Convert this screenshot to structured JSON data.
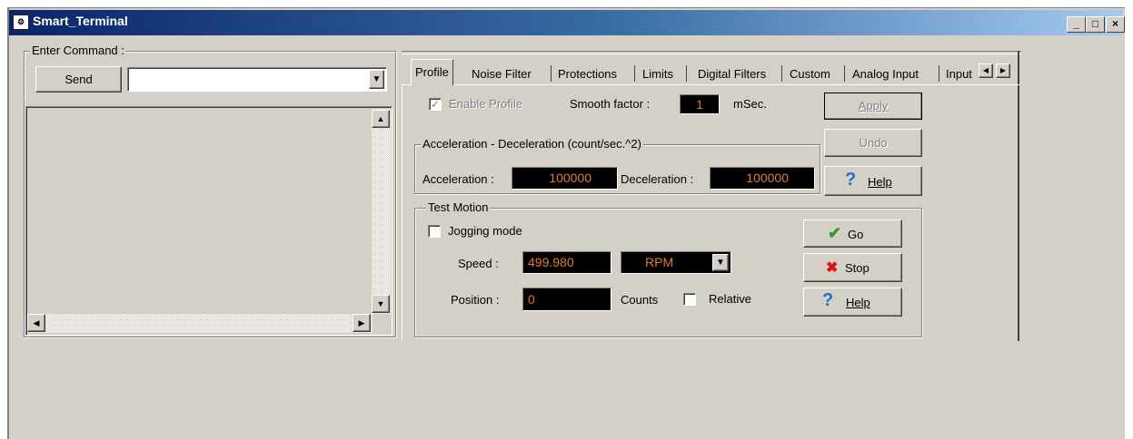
{
  "window": {
    "title": "Smart_Terminal",
    "controls": {
      "minimize": "_",
      "maximize": "□",
      "close": "×"
    },
    "app_icon": "terminal-app-icon"
  },
  "command_panel": {
    "group_label": "Enter Command :",
    "send_label": "Send",
    "command_value": ""
  },
  "tabs": {
    "items": [
      "Profile",
      "Noise Filter",
      "Protections",
      "Limits",
      "Digital Filters",
      "Custom",
      "Analog Input",
      "Input"
    ],
    "selected": "Profile"
  },
  "profile": {
    "enable_profile_label": "Enable Profile",
    "enable_profile_checked": true,
    "smooth_factor_label": "Smooth factor :",
    "smooth_factor_value": "1",
    "smooth_factor_unit": "mSec.",
    "apply_label": "Apply",
    "undo_label": "Undo",
    "help_label": "Help",
    "accel_group_label": "Acceleration - Deceleration (count/sec.^2)",
    "acceleration_label": "Acceleration :",
    "acceleration_value": "100000",
    "deceleration_label": "Deceleration :",
    "deceleration_value": "100000"
  },
  "test_motion": {
    "group_label": "Test Motion",
    "jogging_label": "Jogging mode",
    "jogging_checked": false,
    "speed_label": "Speed :",
    "speed_value": "499.980",
    "speed_unit": "RPM",
    "position_label": "Position :",
    "position_value": "0",
    "position_unit": "Counts",
    "relative_label": "Relative",
    "relative_checked": false,
    "go_label": "Go",
    "stop_label": "Stop",
    "help_label": "Help"
  },
  "colors": {
    "lcd_background": "#000000",
    "lcd_text": "#e07b30",
    "go_icon": "#2e9a2e",
    "stop_icon": "#d11",
    "help_icon": "#1e6fc8"
  }
}
